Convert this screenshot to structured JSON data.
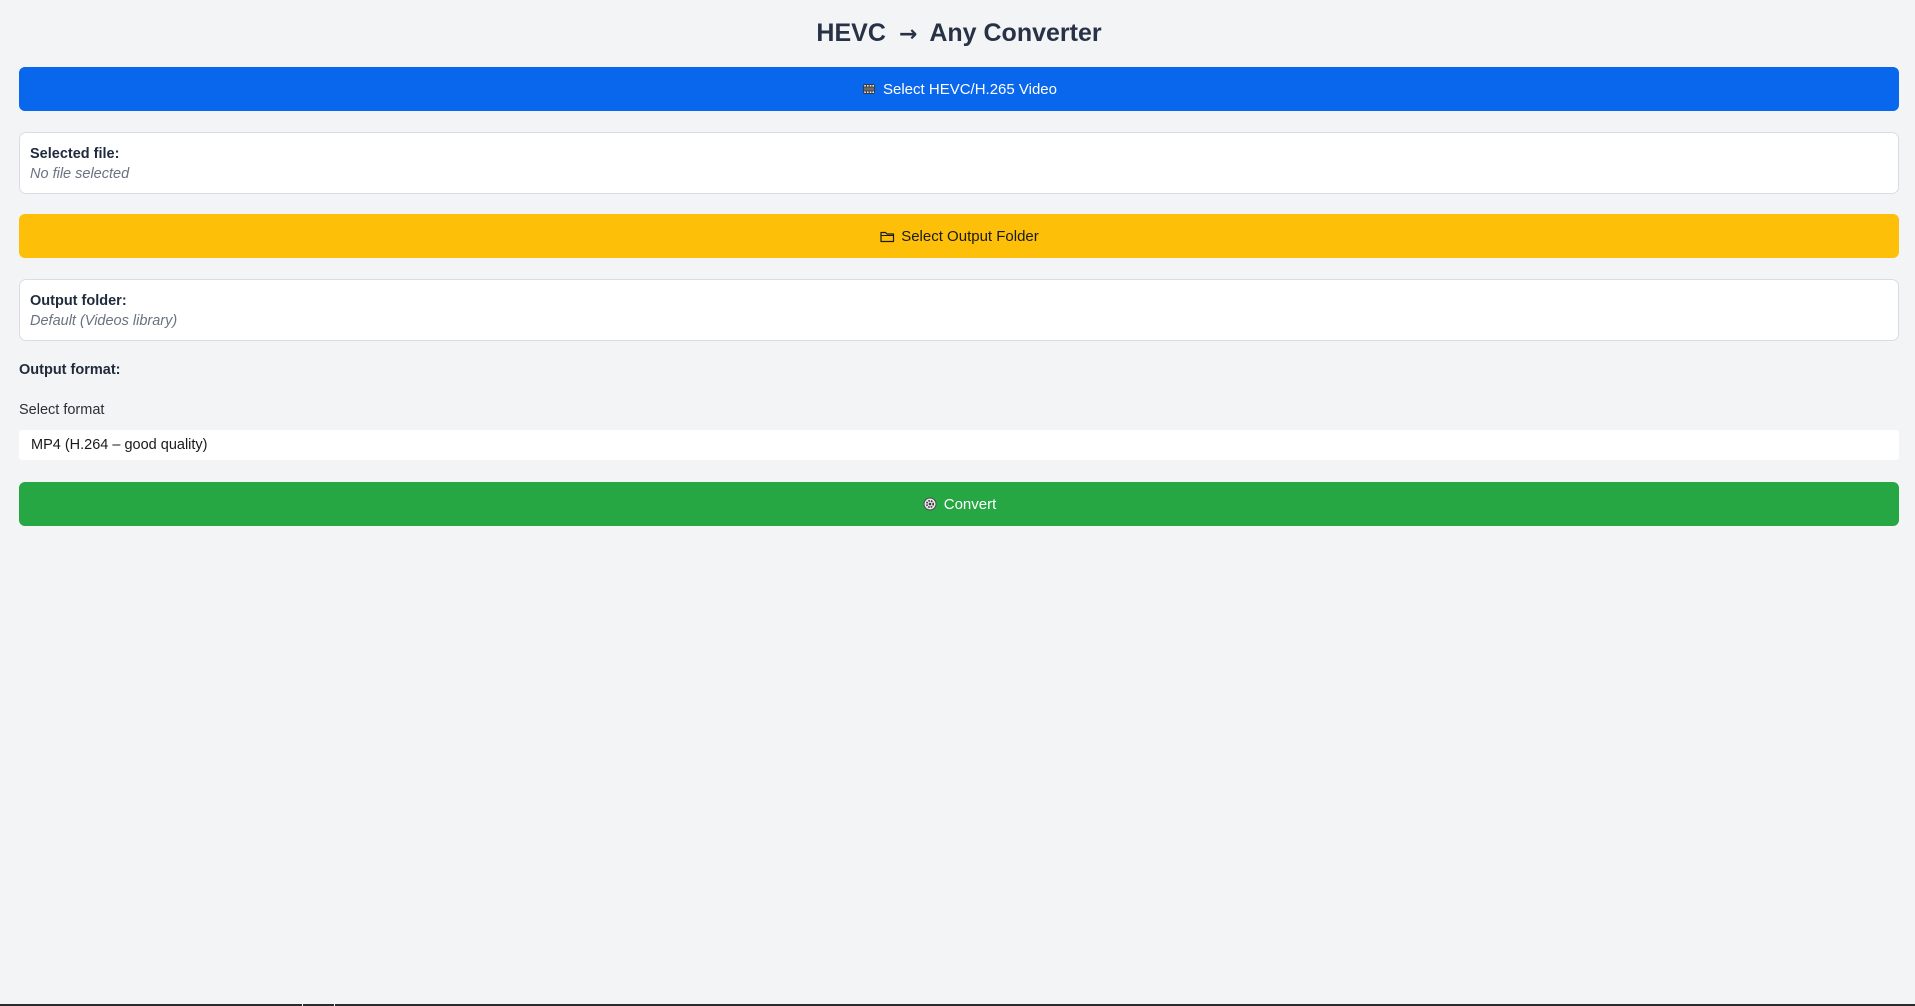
{
  "app": {
    "title_left": "HEVC",
    "title_arrow": "→",
    "title_right": "Any Converter"
  },
  "buttons": {
    "select_video": {
      "label": "Select HEVC/H.265 Video",
      "icon": "film-icon",
      "color": "#0867ec"
    },
    "select_folder": {
      "label": "Select Output Folder",
      "icon": "folder-icon",
      "color": "#fdbf08"
    },
    "convert": {
      "label": "Convert",
      "icon": "gear-icon",
      "color": "#27a744"
    }
  },
  "selected_file": {
    "label": "Selected file:",
    "value": "No file selected"
  },
  "output_folder": {
    "label": "Output folder:",
    "value": "Default (Videos library)"
  },
  "output_format": {
    "heading": "Output format:",
    "select_label": "Select format",
    "selected": "MP4 (H.264 – good quality)"
  }
}
